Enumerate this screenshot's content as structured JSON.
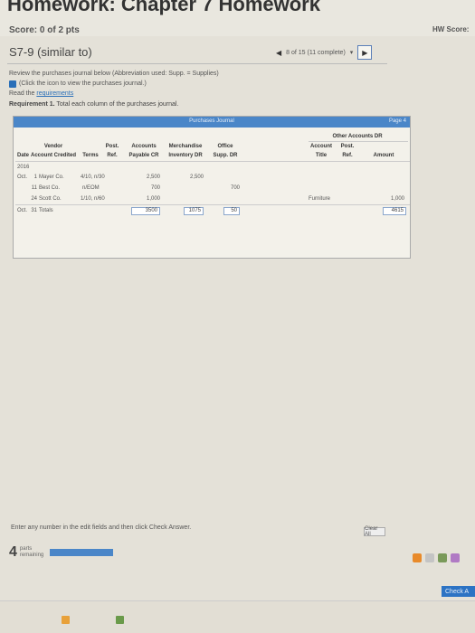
{
  "header": {
    "title": "Homework: Chapter 7 Homework",
    "score_label": "Score:",
    "score_value": "0 of 2 pts",
    "hw_score_label": "HW Score:"
  },
  "problem": {
    "title": "S7-9 (similar to)",
    "position": "8 of 15 (11 complete)"
  },
  "intro": {
    "line1": "Review the purchases journal below (Abbreviation used: Supp. = Supplies)",
    "line2": "(Click the icon to view the purchases journal.)",
    "read_prefix": "Read the",
    "requirements_link": "requirements"
  },
  "requirement": {
    "label": "Requirement 1.",
    "text": "Total each column of the purchases journal."
  },
  "journal": {
    "title": "Purchases Journal",
    "page": "Page 4",
    "headers": {
      "date": "Date",
      "vendor_l1": "Vendor",
      "vendor_l2": "Account Credited",
      "terms": "Terms",
      "post_l1": "Post.",
      "post_l2": "Ref.",
      "ap_l1": "Accounts",
      "ap_l2": "Payable CR",
      "merch_l1": "Merchandise",
      "merch_l2": "Inventory DR",
      "office_l1": "Office",
      "office_l2": "Supp. DR",
      "other_group": "Other Accounts DR",
      "acct_l1": "Account",
      "acct_l2": "Title",
      "opost_l1": "Post.",
      "opost_l2": "Ref.",
      "amount": "Amount"
    },
    "year": "2016",
    "rows": [
      {
        "month": "Oct.",
        "day": "1",
        "vendor": "Mayer Co.",
        "terms": "4/10, n/30",
        "ap": "2,500",
        "merch": "2,500",
        "office": "",
        "acct": "",
        "amount": ""
      },
      {
        "month": "",
        "day": "11",
        "vendor": "Best Co.",
        "terms": "n/EOM",
        "ap": "700",
        "merch": "",
        "office": "700",
        "acct": "",
        "amount": ""
      },
      {
        "month": "",
        "day": "24",
        "vendor": "Scott Co.",
        "terms": "1/10, n/60",
        "ap": "1,000",
        "merch": "",
        "office": "",
        "acct": "Furniture",
        "amount": "1,000"
      }
    ],
    "totals": {
      "month": "Oct.",
      "day": "31",
      "label": "Totals",
      "ap": "3500",
      "merch": "1075",
      "office": "50",
      "amount": "4615"
    }
  },
  "footer": {
    "instruction": "Enter any number in the edit fields and then click Check Answer.",
    "clear_all": "Clear All",
    "parts_count": "4",
    "parts_l1": "parts",
    "parts_l2": "remaining",
    "check_answer": "Check A"
  },
  "colors": {
    "accent": "#4a86c8",
    "link": "#2a6fb8"
  }
}
